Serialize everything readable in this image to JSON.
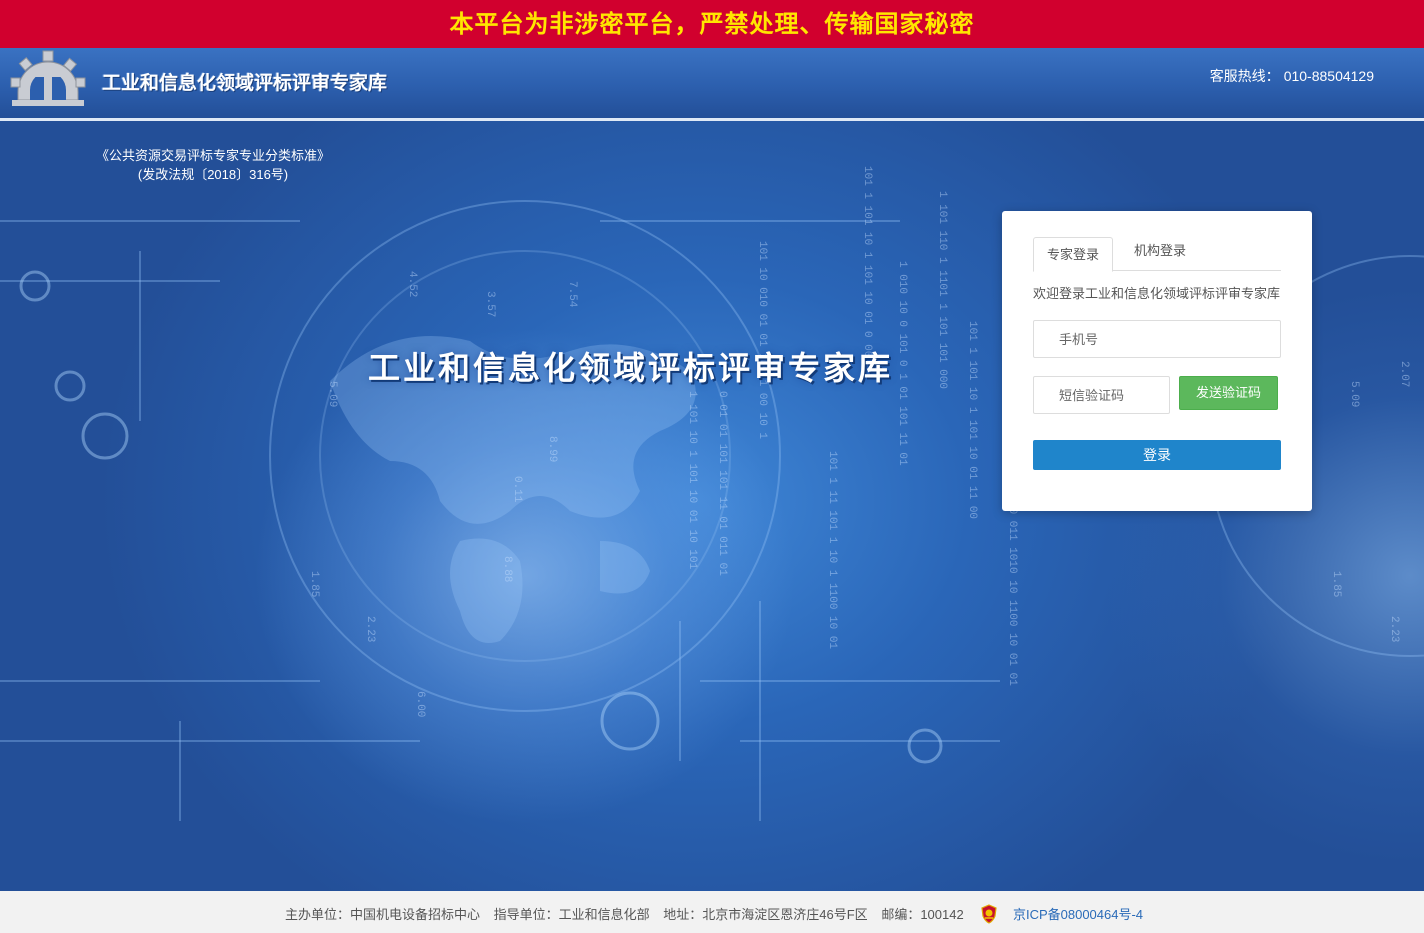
{
  "warning": "本平台为非涉密平台，严禁处理、传输国家秘密",
  "header": {
    "title": "工业和信息化领域评标评审专家库",
    "hotline_label": "客服热线：",
    "hotline_number": "010-88504129"
  },
  "standard": {
    "line1": "《公共资源交易评标专家专业分类标准》",
    "line2": "(发改法规〔2018〕316号)"
  },
  "hero_title": "工业和信息化领域评标评审专家库",
  "login": {
    "tabs": [
      "专家登录",
      "机构登录"
    ],
    "active_tab": "专家登录",
    "welcome": "欢迎登录工业和信息化领域评标评审专家库",
    "phone_placeholder": "手机号",
    "sms_placeholder": "短信验证码",
    "send_code_label": "发送验证码",
    "submit_label": "登录",
    "send_code_color": "#5cb85c",
    "submit_color": "#1f85cb"
  },
  "footer": {
    "sponsor": "主办单位：中国机电设备招标中心",
    "guide": "指导单位：工业和信息化部",
    "address": "地址：北京市海淀区恩济庄46号F区",
    "postcode": "邮编：100142",
    "icp": "京ICP备08000464号-4"
  },
  "icons": {
    "logo": "gear-logo-icon",
    "footer_badge": "police-badge-icon"
  },
  "colors": {
    "warning_bg": "#d1002e",
    "warning_text": "#ffe600",
    "header_bg": "#2c5fae"
  }
}
